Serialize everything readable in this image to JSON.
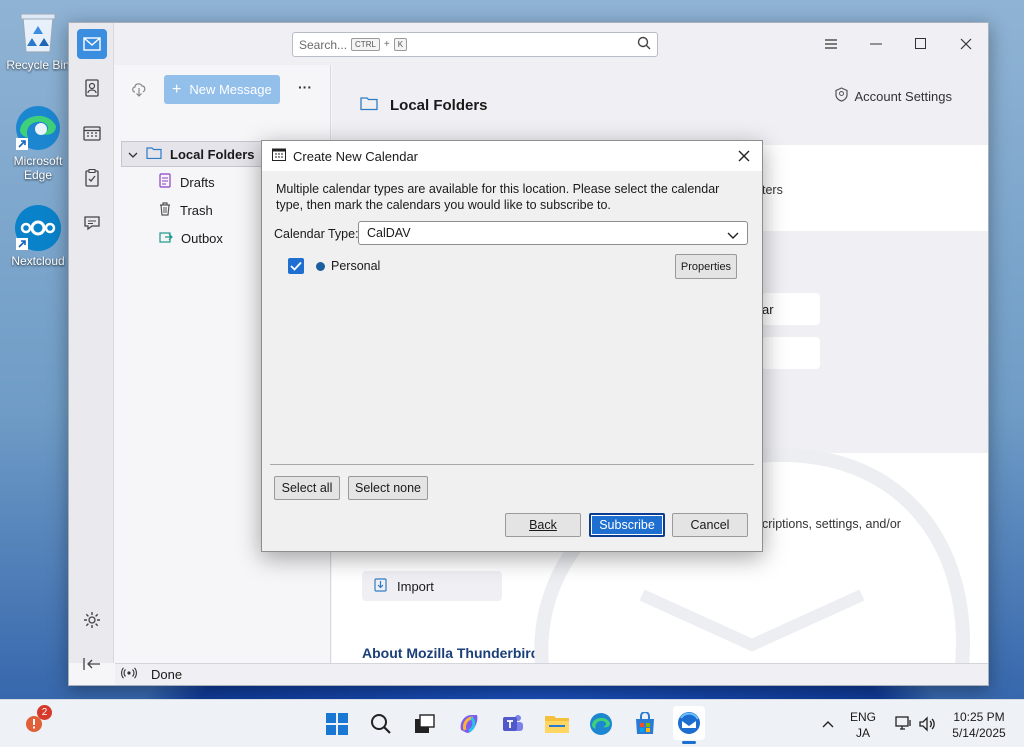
{
  "desktop": {
    "icons": [
      {
        "label": "Recycle Bin",
        "icon": "recycle-bin-icon"
      },
      {
        "label": "Microsoft Edge",
        "icon": "edge-icon"
      },
      {
        "label": "Nextcloud",
        "icon": "nextcloud-icon"
      }
    ]
  },
  "app": {
    "search_placeholder": "Search...",
    "search_shortcut_mod": "CTRL",
    "search_shortcut_plus": "+",
    "search_shortcut_key": "K",
    "new_message_label": "New Message",
    "more_label": "···",
    "folders": [
      {
        "label": "Local Folders",
        "icon": "folder-icon",
        "selected": true
      },
      {
        "label": "Drafts",
        "icon": "drafts-icon"
      },
      {
        "label": "Trash",
        "icon": "trash-icon"
      },
      {
        "label": "Outbox",
        "icon": "outbox-icon"
      }
    ],
    "main_title": "Local Folders",
    "account_settings_label": "Account Settings",
    "partial_text_filters": "ters",
    "partial_text_calendar": "ar",
    "partial_text_subscriptions": "criptions, settings, and/or",
    "import_label": "Import",
    "about_heading": "About Mozilla Thunderbird",
    "status_text": "Done"
  },
  "dialog": {
    "title": "Create New Calendar",
    "description": "Multiple calendar types are available for this location. Please select the calendar type, then mark the calendars you would like to subscribe to.",
    "calendar_type_label": "Calendar Type:",
    "calendar_type_value": "CalDAV",
    "calendars": [
      {
        "name": "Personal",
        "checked": true,
        "color": "#1b5fa0",
        "properties_label": "Properties"
      }
    ],
    "select_all_label": "Select all",
    "select_none_label": "Select none",
    "back_label": "Back",
    "subscribe_label": "Subscribe",
    "cancel_label": "Cancel"
  },
  "taskbar": {
    "notification_count": "2",
    "language_line1": "ENG",
    "language_line2": "JA",
    "time": "10:25 PM",
    "date": "5/14/2025"
  }
}
